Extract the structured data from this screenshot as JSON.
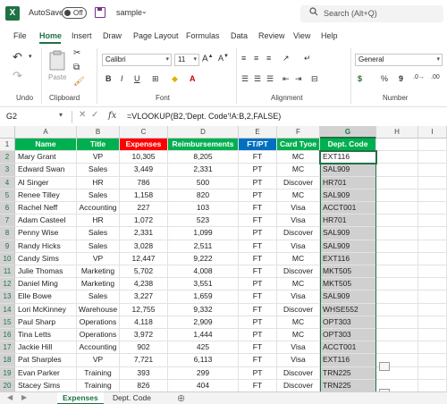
{
  "titlebar": {
    "autosave_label": "AutoSave",
    "toggle_state": "Off",
    "filename": "sample",
    "search_placeholder": "Search (Alt+Q)"
  },
  "menu": [
    "File",
    "Home",
    "Insert",
    "Draw",
    "Page Layout",
    "Formulas",
    "Data",
    "Review",
    "View",
    "Help"
  ],
  "ribbon": {
    "groups": {
      "undo": "Undo",
      "clipboard": "Clipboard",
      "font": "Font",
      "alignment": "Alignment",
      "number": "Number"
    },
    "paste_label": "Paste",
    "font_name": "Calibri",
    "font_size": "11",
    "number_format": "General",
    "percent": "%",
    "comma": "9",
    "dollar": "$"
  },
  "formula_bar": {
    "cell_ref": "G2",
    "formula": "=VLOOKUP(B2,'Dept. Code'!A:B,2,FALSE)"
  },
  "grid": {
    "columns": [
      "A",
      "B",
      "C",
      "D",
      "E",
      "F",
      "G",
      "H",
      "I"
    ],
    "headers": [
      "Name",
      "Title",
      "Expenses",
      "Reimbursements",
      "FT/PT",
      "Card Tyoe",
      "Dept. Code"
    ],
    "header_colors": [
      "#00b050",
      "#00b050",
      "#ff0000",
      "#00b050",
      "#0070c0",
      "#00b050",
      "#00b050"
    ],
    "rows": [
      [
        "Mary Grant",
        "VP",
        "10,305",
        "8,205",
        "FT",
        "MC",
        "EXT116"
      ],
      [
        "Edward Swan",
        "Sales",
        "3,449",
        "2,331",
        "PT",
        "MC",
        "SAL909"
      ],
      [
        "Al Singer",
        "HR",
        "786",
        "500",
        "PT",
        "Discover",
        "HR701"
      ],
      [
        "Renee Tilley",
        "Sales",
        "1,158",
        "820",
        "PT",
        "MC",
        "SAL909"
      ],
      [
        "Rachel Neff",
        "Accounting",
        "227",
        "103",
        "FT",
        "Visa",
        "ACCT001"
      ],
      [
        "Adam Casteel",
        "HR",
        "1,072",
        "523",
        "FT",
        "Visa",
        "HR701"
      ],
      [
        "Penny Wise",
        "Sales",
        "2,331",
        "1,099",
        "PT",
        "Discover",
        "SAL909"
      ],
      [
        "Randy Hicks",
        "Sales",
        "3,028",
        "2,511",
        "FT",
        "Visa",
        "SAL909"
      ],
      [
        "Candy Sims",
        "VP",
        "12,447",
        "9,222",
        "FT",
        "MC",
        "EXT116"
      ],
      [
        "Julie Thomas",
        "Marketing",
        "5,702",
        "4,008",
        "FT",
        "Discover",
        "MKT505"
      ],
      [
        "Daniel Ming",
        "Marketing",
        "4,238",
        "3,551",
        "PT",
        "MC",
        "MKT505"
      ],
      [
        "Elle Bowe",
        "Sales",
        "3,227",
        "1,659",
        "FT",
        "Visa",
        "SAL909"
      ],
      [
        "Lori McKinney",
        "Warehouse",
        "12,755",
        "9,332",
        "FT",
        "Discover",
        "WHSE552"
      ],
      [
        "Paul Sharp",
        "Operations",
        "4,118",
        "2,909",
        "PT",
        "MC",
        "OPT303"
      ],
      [
        "Tina Letts",
        "Operations",
        "3,972",
        "1,444",
        "PT",
        "MC",
        "OPT303"
      ],
      [
        "Jackie Hill",
        "Accounting",
        "902",
        "425",
        "FT",
        "Visa",
        "ACCT001"
      ],
      [
        "Pat Sharples",
        "VP",
        "7,721",
        "6,113",
        "FT",
        "Visa",
        "EXT116"
      ],
      [
        "Evan Parker",
        "Training",
        "393",
        "299",
        "PT",
        "Discover",
        "TRN225"
      ],
      [
        "Stacey Sims",
        "Training",
        "826",
        "404",
        "FT",
        "Discover",
        "TRN225"
      ]
    ],
    "row_numbers": [
      "1",
      "2",
      "3",
      "4",
      "5",
      "6",
      "7",
      "8",
      "9",
      "10",
      "11",
      "12",
      "13",
      "14",
      "15",
      "16",
      "17",
      "18",
      "19",
      "20",
      "21"
    ]
  },
  "sheets": [
    "Expenses",
    "Dept. Code"
  ],
  "active_sheet": "Expenses",
  "accent_color": "#1f7244"
}
